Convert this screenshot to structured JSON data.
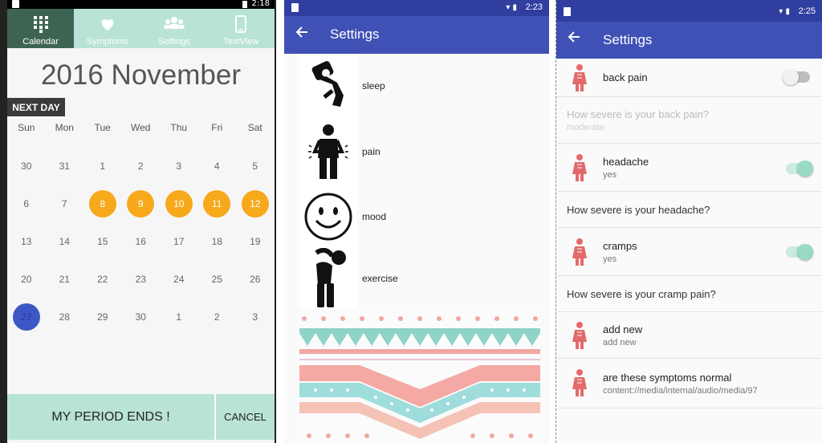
{
  "calendar_app": {
    "status_time": "2:18",
    "tabs": [
      {
        "label": "Calendar",
        "icon": "keypad-icon",
        "active": true
      },
      {
        "label": "Symptoms",
        "icon": "heart-icon",
        "active": false
      },
      {
        "label": "Settings",
        "icon": "people-icon",
        "active": false
      },
      {
        "label": "TextView",
        "icon": "phone-icon",
        "active": false
      }
    ],
    "month_title": "2016 November",
    "next_day_label": "NEXT DAY",
    "weekdays": [
      "Sun",
      "Mon",
      "Tue",
      "Wed",
      "Thu",
      "Fri",
      "Sat"
    ],
    "weeks": [
      [
        "30",
        "31",
        "1",
        "2",
        "3",
        "4",
        "5"
      ],
      [
        "6",
        "7",
        "8",
        "9",
        "10",
        "11",
        "12"
      ],
      [
        "13",
        "14",
        "15",
        "16",
        "17",
        "18",
        "19"
      ],
      [
        "20",
        "21",
        "22",
        "23",
        "24",
        "25",
        "26"
      ],
      [
        "27",
        "28",
        "29",
        "30",
        "1",
        "2",
        "3"
      ]
    ],
    "period_days": [
      "8",
      "9",
      "10",
      "11",
      "12"
    ],
    "today": "27",
    "period_ends_label": "MY PERIOD ENDS !",
    "cancel_label": "CANCEL",
    "colors": {
      "tab_bar": "#b9e3d7",
      "tab_active": "#3d6452",
      "period": "#f7a81b",
      "today": "#3d58c4"
    }
  },
  "settings_icons": {
    "status_time": "2:23",
    "title": "Settings",
    "items": [
      {
        "label": "sleep",
        "icon": "sleeping-person-icon"
      },
      {
        "label": "pain",
        "icon": "stomach-pain-icon"
      },
      {
        "label": "mood",
        "icon": "smiley-face-icon"
      },
      {
        "label": "exercise",
        "icon": "stretching-person-icon"
      }
    ],
    "colors": {
      "appbar": "#3f51b5",
      "statusbar": "#303f9f"
    }
  },
  "symptom_settings": {
    "status_time": "2:25",
    "title": "Settings",
    "rows": [
      {
        "title": "back pain",
        "summary": "",
        "switch": "off"
      },
      {
        "title": "How severe is your back pain?",
        "summary": "moderate",
        "disabled": true
      },
      {
        "title": "headache",
        "summary": "yes",
        "switch": "on"
      },
      {
        "title": "How severe is your headache?"
      },
      {
        "title": "cramps",
        "summary": "yes",
        "switch": "on"
      },
      {
        "title": "How severe is your cramp pain?"
      },
      {
        "title": "add new",
        "summary": "add new"
      },
      {
        "title": "are these symptoms normal",
        "summary": "content://media/internal/audio/media/97"
      }
    ]
  }
}
